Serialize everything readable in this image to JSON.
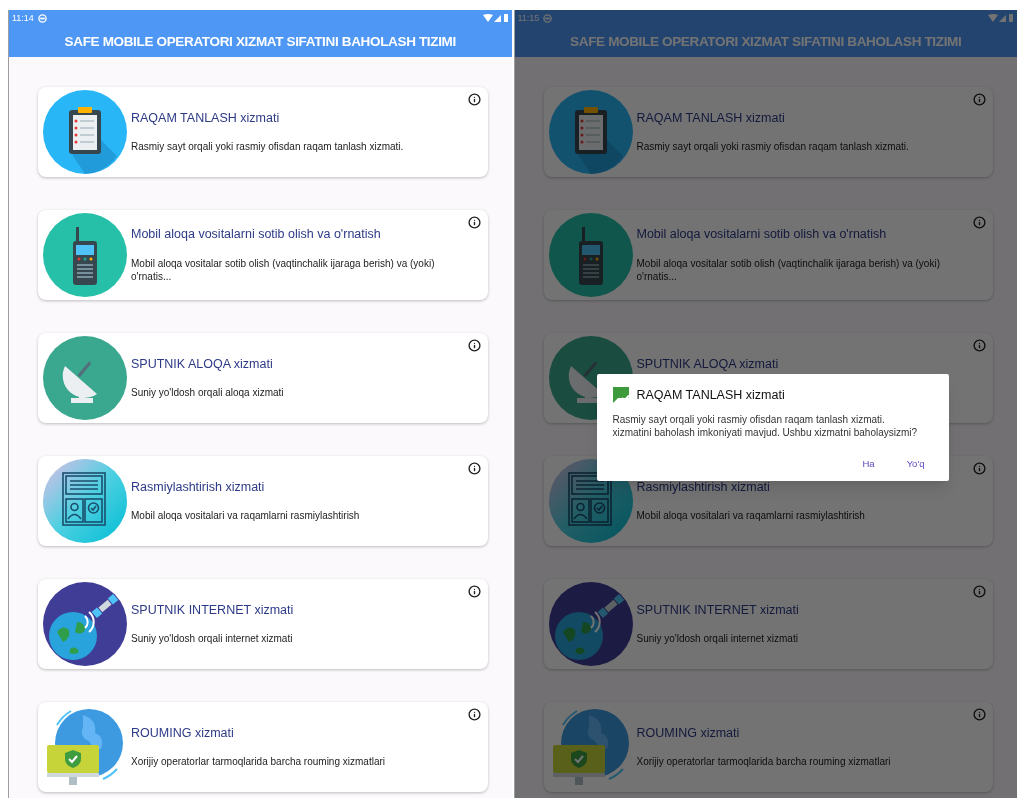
{
  "screens": [
    {
      "time": "11:14",
      "title": "SAFE MOBILE OPERATORI XIZMAT SIFATINI BAHOLASH TIZIMI",
      "dimmed": false,
      "services": [
        {
          "kind": "clipboard",
          "title": "RAQAM TANLASH xizmati",
          "description": "Rasmiy sayt orqali yoki rasmiy ofisdan raqam tanlash xizmati."
        },
        {
          "kind": "radio",
          "title": "Mobil aloqa vositalarni sotib olish va o'rnatish",
          "description": "Mobil aloqa vositalar sotib olish (vaqtinchalik ijaraga berish) va (yoki) o'rnatis..."
        },
        {
          "kind": "dish",
          "title": "SPUTNIK ALOQA xizmati",
          "description": "Suniy yo'ldosh orqali aloqa xizmati"
        },
        {
          "kind": "document",
          "title": "Rasmiylashtirish xizmati",
          "description": "Mobil aloqa vositalari va raqamlarni rasmiylashtirish"
        },
        {
          "kind": "earth",
          "title": "SPUTNIK INTERNET xizmati",
          "description": "Suniy yo'ldosh orqali internet xizmati"
        },
        {
          "kind": "globe",
          "title": "ROUMING xizmati",
          "description": "Xorijiy operatorlar tarmoqlarida barcha rouming xizmatlari"
        }
      ]
    },
    {
      "time": "11:15",
      "title": "SAFE MOBILE OPERATORI XIZMAT SIFATINI BAHOLASH TIZIMI",
      "dimmed": true,
      "services": [
        {
          "kind": "clipboard",
          "title": "RAQAM TANLASH xizmati",
          "description": "Rasmiy sayt orqali yoki rasmiy ofisdan raqam tanlash xizmati."
        },
        {
          "kind": "radio",
          "title": "Mobil aloqa vositalarni sotib olish va o'rnatish",
          "description": "Mobil aloqa vositalar sotib olish (vaqtinchalik ijaraga berish) va (yoki) o'rnatis..."
        },
        {
          "kind": "dish",
          "title": "SPUTNIK ALOQA xizmati"
        },
        {
          "kind": "document",
          "title": "Rasmiylashtirish xizmati",
          "description": "Mobil aloqa vositalari va raqamlarni rasmiylashtirish"
        },
        {
          "kind": "earth",
          "title": "SPUTNIK INTERNET xizmati",
          "description": "Suniy yo'ldosh orqali internet xizmati"
        },
        {
          "kind": "globe",
          "title": "ROUMING xizmati",
          "description": "Xorijiy operatorlar tarmoqlarida barcha rouming xizmatlari"
        }
      ],
      "dialog": {
        "title": "RAQAM TANLASH xizmati",
        "message": "Rasmiy sayt orqali yoki rasmiy ofisdan raqam tanlash xizmati.\nxizmatini baholash imkoniyati mavjud. Ushbu xizmatni baholaysizmi?",
        "buttons": [
          "Ha",
          "Yo'q"
        ]
      }
    }
  ]
}
